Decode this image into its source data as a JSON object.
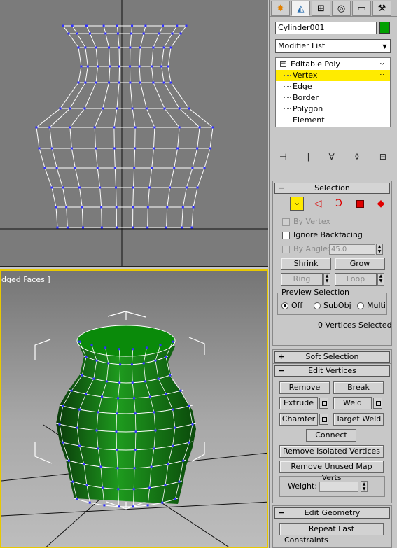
{
  "viewports": {
    "perspective_label": "dged Faces ]"
  },
  "tabs": [
    {
      "icon": "create-icon"
    },
    {
      "icon": "modify-icon"
    },
    {
      "icon": "hierarchy-icon"
    },
    {
      "icon": "motion-icon"
    },
    {
      "icon": "display-icon"
    },
    {
      "icon": "utilities-icon"
    }
  ],
  "object": {
    "name": "Cylinder001",
    "color": "#00a000"
  },
  "modifier_list": {
    "value": "Modifier List"
  },
  "stack": {
    "root": "Editable Poly",
    "items": [
      "Vertex",
      "Edge",
      "Border",
      "Polygon",
      "Element"
    ],
    "selected": "Vertex"
  },
  "selection": {
    "title": "Selection",
    "by_vertex": "By Vertex",
    "ignore_backfacing": "Ignore Backfacing",
    "by_angle": "By Angle:",
    "angle_value": "45.0",
    "shrink": "Shrink",
    "grow": "Grow",
    "ring": "Ring",
    "loop": "Loop",
    "preview_title": "Preview Selection",
    "preview_options": [
      "Off",
      "SubObj",
      "Multi"
    ],
    "preview_selected": "Off",
    "status": "0 Vertices Selected"
  },
  "soft_selection": {
    "title": "Soft Selection"
  },
  "edit_vertices": {
    "title": "Edit Vertices",
    "remove": "Remove",
    "break": "Break",
    "extrude": "Extrude",
    "weld": "Weld",
    "chamfer": "Chamfer",
    "target_weld": "Target Weld",
    "connect": "Connect",
    "remove_isolated": "Remove Isolated Vertices",
    "remove_unused": "Remove Unused Map Verts",
    "weight_label": "Weight:"
  },
  "edit_geometry": {
    "title": "Edit Geometry",
    "repeat_last": "Repeat Last",
    "constraints": "Constraints"
  }
}
